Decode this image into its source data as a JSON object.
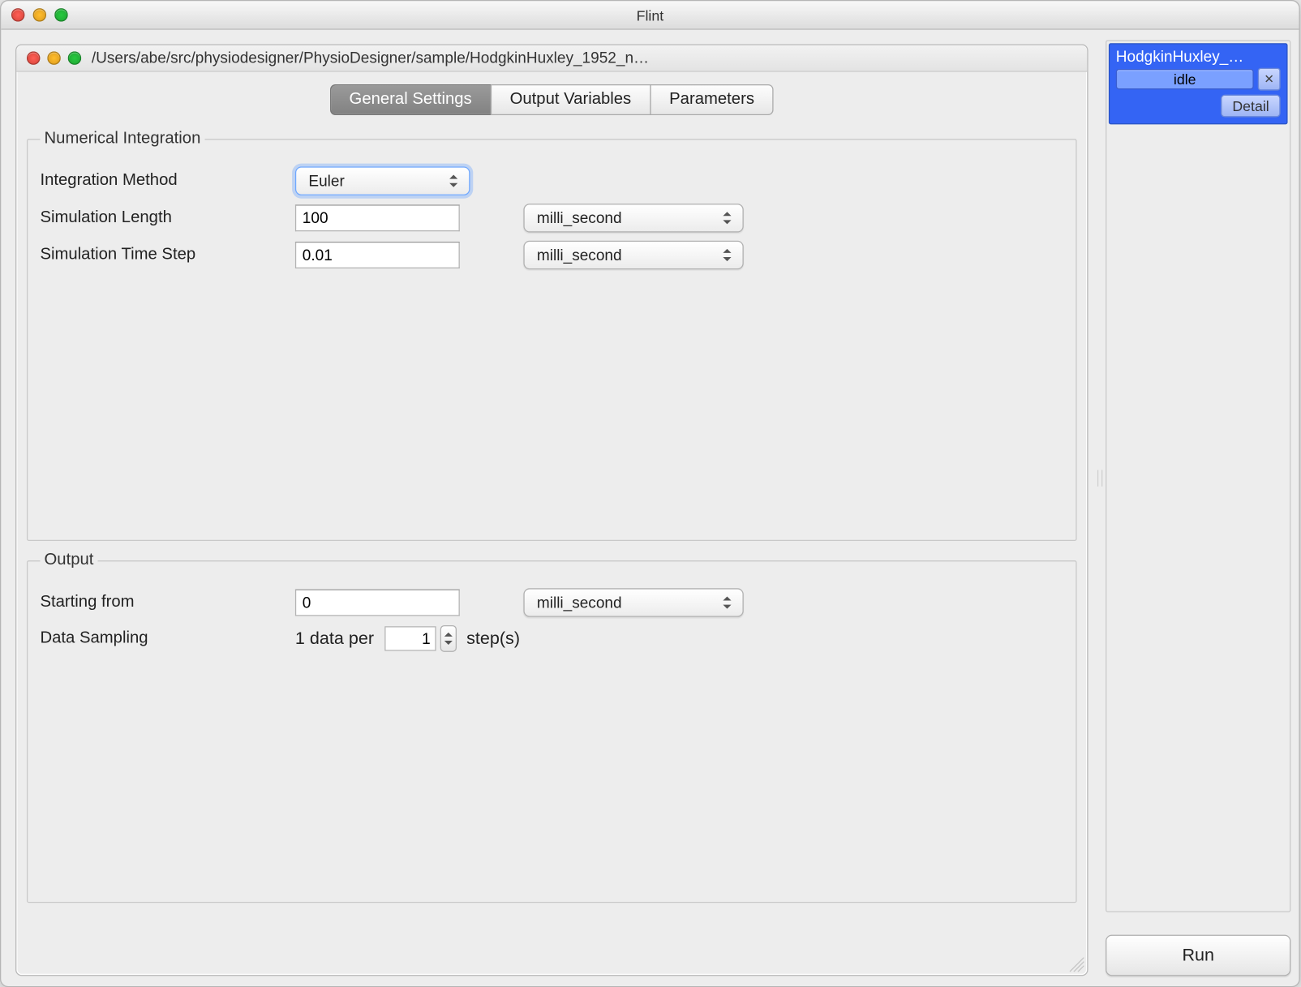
{
  "window": {
    "title": "Flint"
  },
  "sub_window": {
    "path": "/Users/abe/src/physiodesigner/PhysioDesigner/sample/HodgkinHuxley_1952_n…"
  },
  "tabs": {
    "items": [
      "General Settings",
      "Output Variables",
      "Parameters"
    ],
    "active_index": 0
  },
  "groups": {
    "numerical_integration": {
      "legend": "Numerical Integration",
      "integration_method_label": "Integration Method",
      "integration_method_value": "Euler",
      "sim_length_label": "Simulation Length",
      "sim_length_value": "100",
      "sim_length_unit": "milli_second",
      "sim_step_label": "Simulation Time Step",
      "sim_step_value": "0.01",
      "sim_step_unit": "milli_second"
    },
    "output": {
      "legend": "Output",
      "starting_from_label": "Starting from",
      "starting_from_value": "0",
      "starting_from_unit": "milli_second",
      "data_sampling_label": "Data Sampling",
      "data_sampling_prefix": "1 data per",
      "data_sampling_value": "1",
      "data_sampling_suffix": "step(s)"
    }
  },
  "side": {
    "job_title": "HodgkinHuxley_…",
    "job_status": "idle",
    "job_detail": "Detail",
    "run_label": "Run"
  }
}
